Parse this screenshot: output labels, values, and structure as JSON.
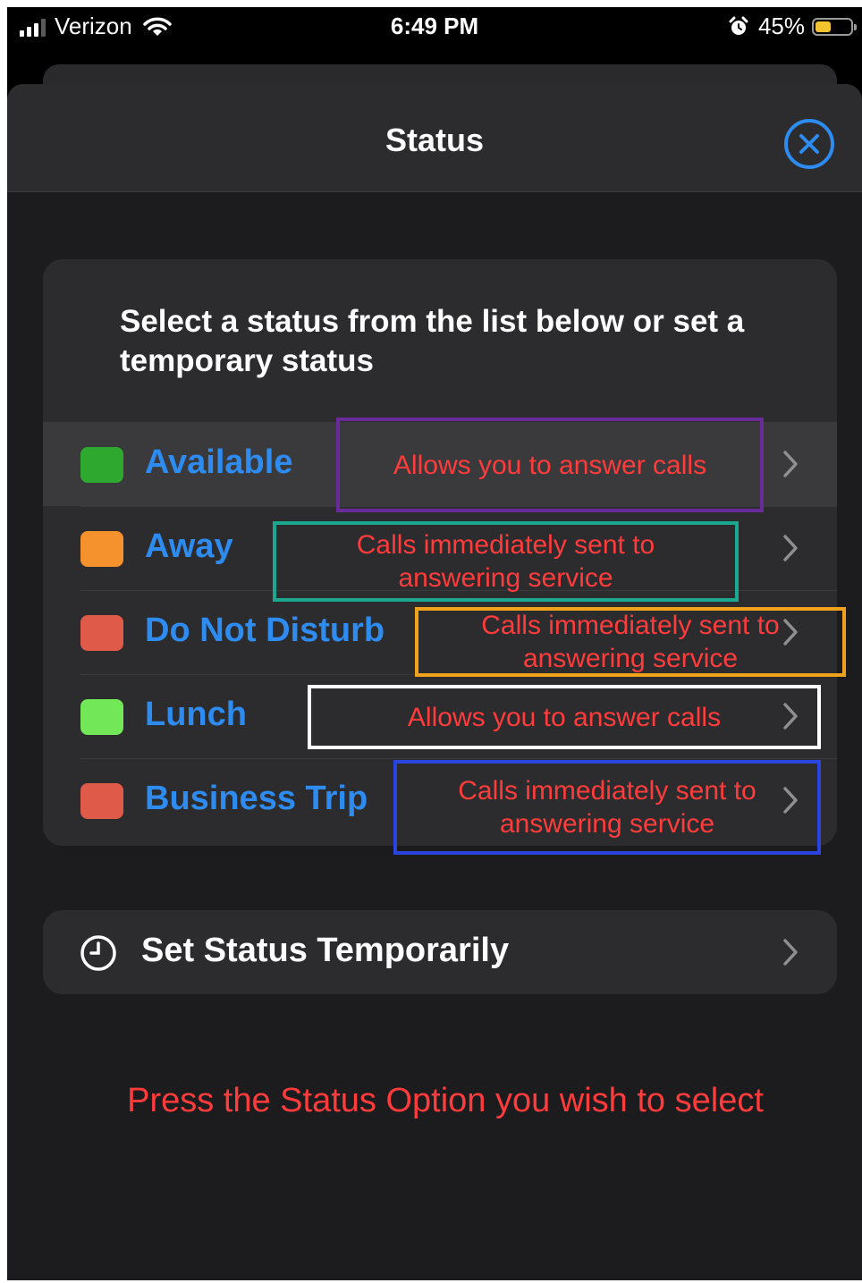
{
  "status_bar": {
    "carrier": "Verizon",
    "time": "6:49 PM",
    "battery": "45%",
    "battery_level": 0.45
  },
  "nav": {
    "title": "Status",
    "close_icon": "close-circle-icon"
  },
  "card": {
    "instruction": "Select a status from the list below or set a temporary status"
  },
  "statuses": [
    {
      "label": "Available",
      "color": "#2fa82f",
      "selected": true
    },
    {
      "label": "Away",
      "color": "#f6922e"
    },
    {
      "label": "Do Not Disturb",
      "color": "#e05a4a"
    },
    {
      "label": "Lunch",
      "color": "#72e858"
    },
    {
      "label": "Business Trip",
      "color": "#e05a4a"
    }
  ],
  "set_temp": {
    "label": "Set Status Temporarily",
    "icon": "clock-icon"
  },
  "annotations": [
    {
      "text": "Allows you to answer calls",
      "border": "#6a2b9a"
    },
    {
      "text": "Calls immediately sent to answering service",
      "border": "#1aa890"
    },
    {
      "text": "Calls immediately sent to answering service",
      "border": "#f0a21a"
    },
    {
      "text": "Allows you to answer calls",
      "border": "#ffffff"
    },
    {
      "text": "Calls immediately sent to answering service",
      "border": "#2a44e0"
    }
  ],
  "footer_note": "Press the Status Option you wish to select"
}
